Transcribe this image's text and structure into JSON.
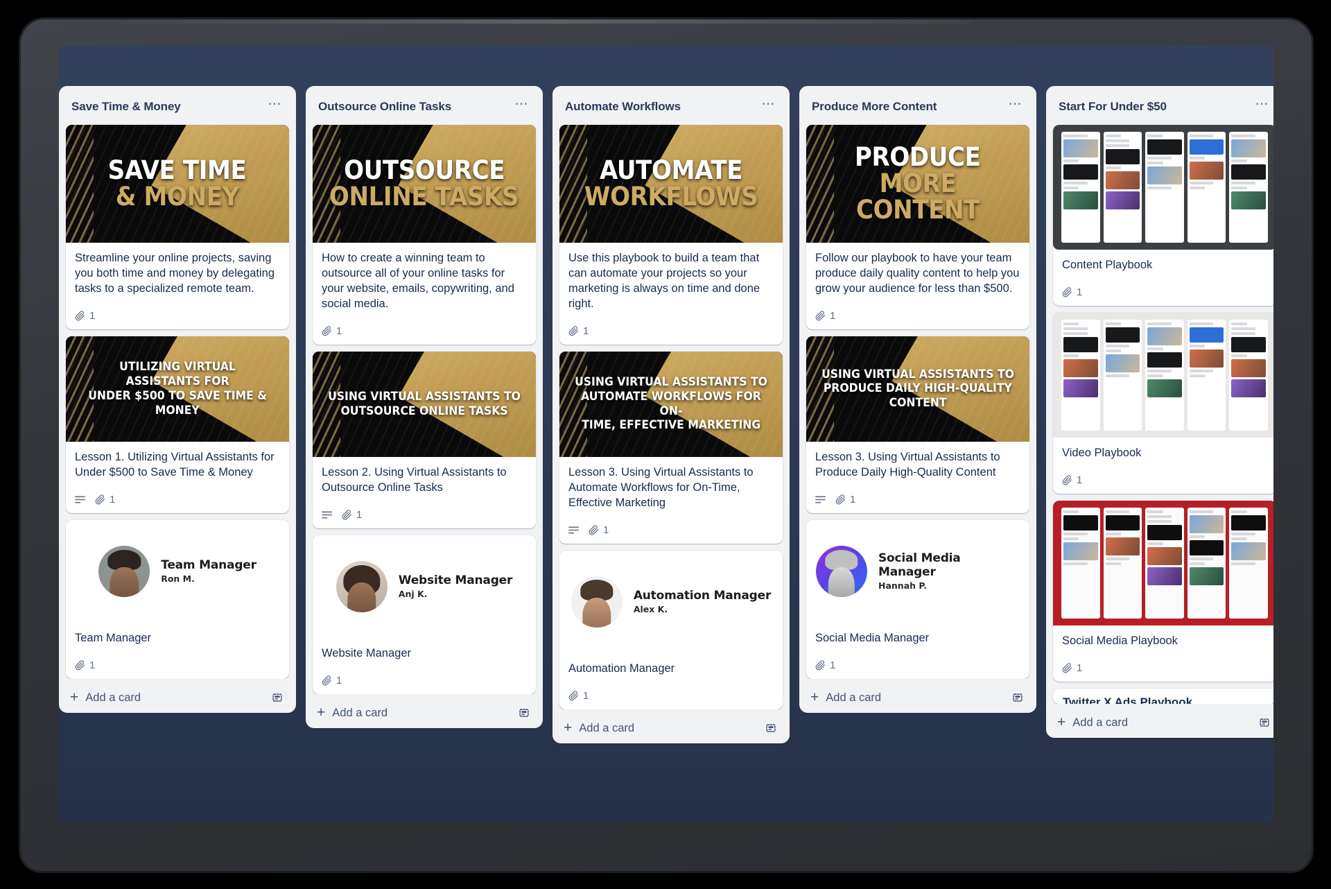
{
  "board": {
    "background_color": "#2d3a55",
    "frame_color": "#33363b"
  },
  "icons": {
    "list_menu": "ellipsis-icon",
    "attachment": "paperclip-icon",
    "description": "description-lines-icon",
    "add": "plus-icon",
    "template": "card-template-icon"
  },
  "footer": {
    "add_card_label": "Add a card"
  },
  "lists": [
    {
      "title": "Save Time & Money",
      "cards": [
        {
          "type": "promo-hero",
          "cover_lines": [
            "SAVE TIME",
            "& MONEY"
          ],
          "text": "Streamline your online projects, saving you both time and money by delegating tasks to a specialized remote team.",
          "attachments": "1",
          "has_description": false
        },
        {
          "type": "promo-lesson",
          "cover_lines": [
            "UTILIZING VIRTUAL ASSISTANTS FOR",
            "UNDER $500 TO SAVE TIME &",
            "MONEY"
          ],
          "text": "Lesson 1. Utilizing Virtual Assistants for Under $500 to Save Time & Money",
          "attachments": "1",
          "has_description": true
        },
        {
          "type": "member",
          "role": "Team Manager",
          "person": "Ron M.",
          "avatar": "ron",
          "text": "Team Manager",
          "attachments": "1",
          "has_description": false
        }
      ]
    },
    {
      "title": "Outsource Online Tasks",
      "cards": [
        {
          "type": "promo-hero",
          "cover_lines": [
            "OUTSOURCE",
            "ONLINE TASKS"
          ],
          "text": "How to create a winning team to outsource all of your online tasks for your website, emails, copywriting, and social media.",
          "attachments": "1",
          "has_description": false
        },
        {
          "type": "promo-lesson",
          "cover_lines": [
            "USING VIRTUAL ASSISTANTS TO",
            "OUTSOURCE ONLINE TASKS"
          ],
          "text": "Lesson 2. Using Virtual Assistants to Outsource Online Tasks",
          "attachments": "1",
          "has_description": true
        },
        {
          "type": "member",
          "role": "Website Manager",
          "person": "Anj K.",
          "avatar": "anj",
          "text": "Website Manager",
          "attachments": "1",
          "has_description": false
        }
      ]
    },
    {
      "title": "Automate Workflows",
      "cards": [
        {
          "type": "promo-hero",
          "cover_lines": [
            "AUTOMATE",
            "WORKFLOWS"
          ],
          "text": "Use this playbook to build a team that can automate your projects so your marketing is always on time and done right.",
          "attachments": "1",
          "has_description": false
        },
        {
          "type": "promo-lesson",
          "cover_lines": [
            "USING VIRTUAL ASSISTANTS TO",
            "AUTOMATE WORKFLOWS FOR ON-",
            "TIME, EFFECTIVE MARKETING"
          ],
          "text": "Lesson 3. Using Virtual Assistants to Automate Workflows for On-Time, Effective Marketing",
          "attachments": "1",
          "has_description": true
        },
        {
          "type": "member",
          "role": "Automation Manager",
          "person": "Alex K.",
          "avatar": "alex",
          "text": "Automation Manager",
          "attachments": "1",
          "has_description": false
        }
      ]
    },
    {
      "title": "Produce More Content",
      "cards": [
        {
          "type": "promo-hero",
          "cover_lines": [
            "PRODUCE",
            "MORE CONTENT"
          ],
          "text": "Follow our playbook to have your team produce daily quality content to help you grow your audience for less than $500.",
          "attachments": "1",
          "has_description": false
        },
        {
          "type": "promo-lesson",
          "cover_lines": [
            "USING VIRTUAL ASSISTANTS TO",
            "PRODUCE DAILY HIGH-QUALITY",
            "CONTENT"
          ],
          "text": "Lesson 3. Using Virtual Assistants to Produce Daily High-Quality Content",
          "attachments": "1",
          "has_description": true
        },
        {
          "type": "member",
          "role": "Social Media Manager",
          "person": "Hannah P.",
          "avatar": "hannah",
          "text": "Social Media Manager",
          "attachments": "1",
          "has_description": false
        }
      ]
    },
    {
      "title": "Start For Under $50",
      "cards": [
        {
          "type": "playbook",
          "style": "dark",
          "text": "Content Playbook",
          "attachments": "1",
          "has_description": false
        },
        {
          "type": "playbook",
          "style": "light",
          "text": "Video Playbook",
          "attachments": "1",
          "has_description": false
        },
        {
          "type": "playbook",
          "style": "red",
          "text": "Social Media Playbook",
          "attachments": "1",
          "has_description": false
        },
        {
          "type": "cut-off",
          "text": "Twitter X Ads Playbook"
        }
      ]
    }
  ]
}
